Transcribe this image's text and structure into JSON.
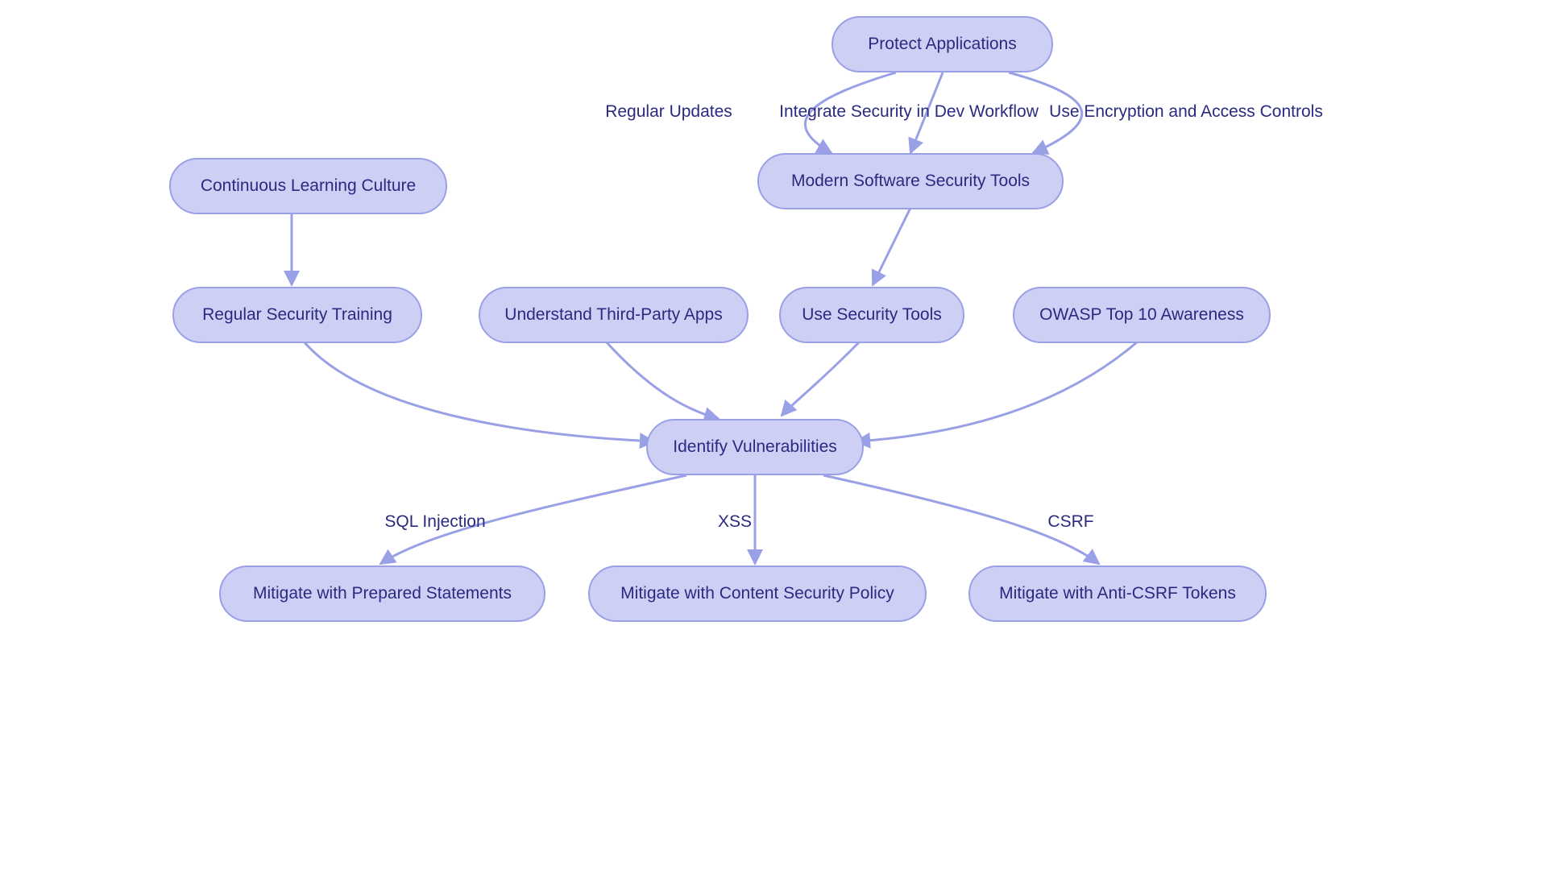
{
  "colors": {
    "node_fill": "#cdd0f4",
    "node_border": "#9aa0e6",
    "edge": "#9aa0e6",
    "text": "#2a2a80"
  },
  "nodes": {
    "protect_applications": "Protect Applications",
    "modern_tools": "Modern Software Security Tools",
    "continuous_learning": "Continuous Learning Culture",
    "regular_training": "Regular Security Training",
    "third_party": "Understand Third-Party Apps",
    "use_tools": "Use Security Tools",
    "owasp": "OWASP Top 10 Awareness",
    "identify_vuln": "Identify Vulnerabilities",
    "mit_sql": "Mitigate with Prepared Statements",
    "mit_csp": "Mitigate with Content Security Policy",
    "mit_csrf": "Mitigate with Anti-CSRF Tokens"
  },
  "edge_labels": {
    "regular_updates": "Regular Updates",
    "integrate_dev": "Integrate Security in Dev Workflow",
    "enc_access": "Use Encryption and Access Controls",
    "sql_injection": "SQL Injection",
    "xss": "XSS",
    "csrf": "CSRF"
  },
  "chart_data": {
    "type": "flowchart",
    "nodes": [
      {
        "id": "protect_applications",
        "label": "Protect Applications"
      },
      {
        "id": "modern_tools",
        "label": "Modern Software Security Tools"
      },
      {
        "id": "continuous_learning",
        "label": "Continuous Learning Culture"
      },
      {
        "id": "regular_training",
        "label": "Regular Security Training"
      },
      {
        "id": "third_party",
        "label": "Understand Third-Party Apps"
      },
      {
        "id": "use_tools",
        "label": "Use Security Tools"
      },
      {
        "id": "owasp",
        "label": "OWASP Top 10 Awareness"
      },
      {
        "id": "identify_vuln",
        "label": "Identify Vulnerabilities"
      },
      {
        "id": "mit_sql",
        "label": "Mitigate with Prepared Statements"
      },
      {
        "id": "mit_csp",
        "label": "Mitigate with Content Security Policy"
      },
      {
        "id": "mit_csrf",
        "label": "Mitigate with Anti-CSRF Tokens"
      }
    ],
    "edges": [
      {
        "from": "protect_applications",
        "to": "modern_tools",
        "label": "Regular Updates"
      },
      {
        "from": "protect_applications",
        "to": "modern_tools",
        "label": "Integrate Security in Dev Workflow"
      },
      {
        "from": "protect_applications",
        "to": "modern_tools",
        "label": "Use Encryption and Access Controls"
      },
      {
        "from": "continuous_learning",
        "to": "regular_training",
        "label": ""
      },
      {
        "from": "modern_tools",
        "to": "use_tools",
        "label": ""
      },
      {
        "from": "regular_training",
        "to": "identify_vuln",
        "label": ""
      },
      {
        "from": "third_party",
        "to": "identify_vuln",
        "label": ""
      },
      {
        "from": "use_tools",
        "to": "identify_vuln",
        "label": ""
      },
      {
        "from": "owasp",
        "to": "identify_vuln",
        "label": ""
      },
      {
        "from": "identify_vuln",
        "to": "mit_sql",
        "label": "SQL Injection"
      },
      {
        "from": "identify_vuln",
        "to": "mit_csp",
        "label": "XSS"
      },
      {
        "from": "identify_vuln",
        "to": "mit_csrf",
        "label": "CSRF"
      }
    ]
  }
}
